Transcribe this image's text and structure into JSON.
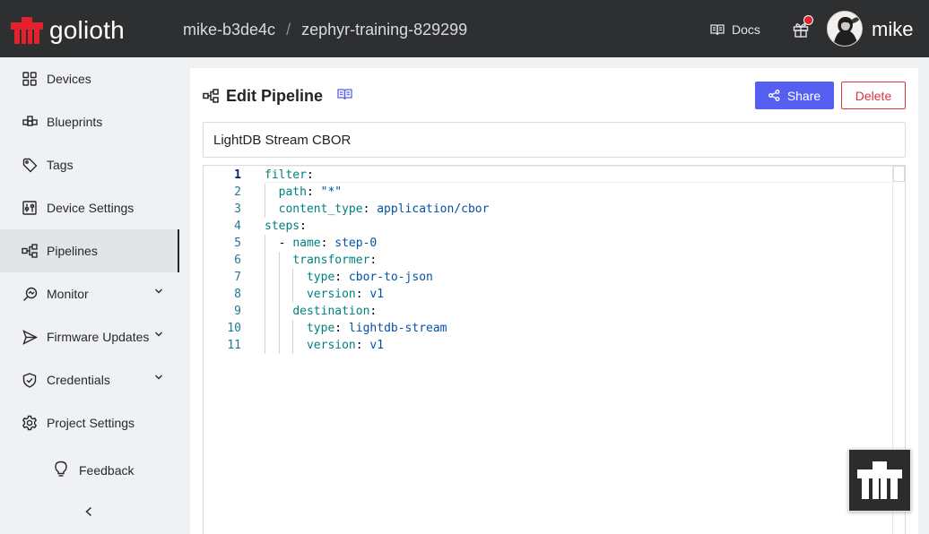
{
  "app": {
    "logo_text": "golioth"
  },
  "breadcrumb": {
    "org": "mike-b3de4c",
    "separator": "/",
    "project": "zephyr-training-829299"
  },
  "header": {
    "docs_label": "Docs",
    "username": "mike"
  },
  "sidebar": {
    "items": [
      {
        "label": "Devices",
        "icon": "devices-icon"
      },
      {
        "label": "Blueprints",
        "icon": "blueprints-icon"
      },
      {
        "label": "Tags",
        "icon": "tag-icon"
      },
      {
        "label": "Device Settings",
        "icon": "settings-sliders-icon"
      },
      {
        "label": "Pipelines",
        "icon": "pipelines-icon",
        "active": true
      },
      {
        "label": "Monitor",
        "icon": "monitor-icon",
        "expandable": true
      },
      {
        "label": "Firmware Updates",
        "icon": "send-icon",
        "expandable": true
      },
      {
        "label": "Credentials",
        "icon": "shield-check-icon",
        "expandable": true
      },
      {
        "label": "Project Settings",
        "icon": "gear-icon"
      }
    ],
    "feedback_label": "Feedback"
  },
  "page": {
    "title": "Edit Pipeline",
    "share_label": "Share",
    "delete_label": "Delete",
    "pipeline_name": "LightDB Stream CBOR"
  },
  "editor": {
    "current_line": 1,
    "lines": [
      "filter:",
      "  path: \"*\"",
      "  content_type: application/cbor",
      "steps:",
      "  - name: step-0",
      "    transformer:",
      "      type: cbor-to-json",
      "      version: v1",
      "    destination:",
      "      type: lightdb-stream",
      "      version: v1"
    ]
  },
  "colors": {
    "topbar": "#2e2f31",
    "accent": "#5560f0",
    "danger": "#d63541",
    "brand": "#e4222e",
    "yaml_key": "#008080",
    "yaml_value": "#0451a5"
  }
}
